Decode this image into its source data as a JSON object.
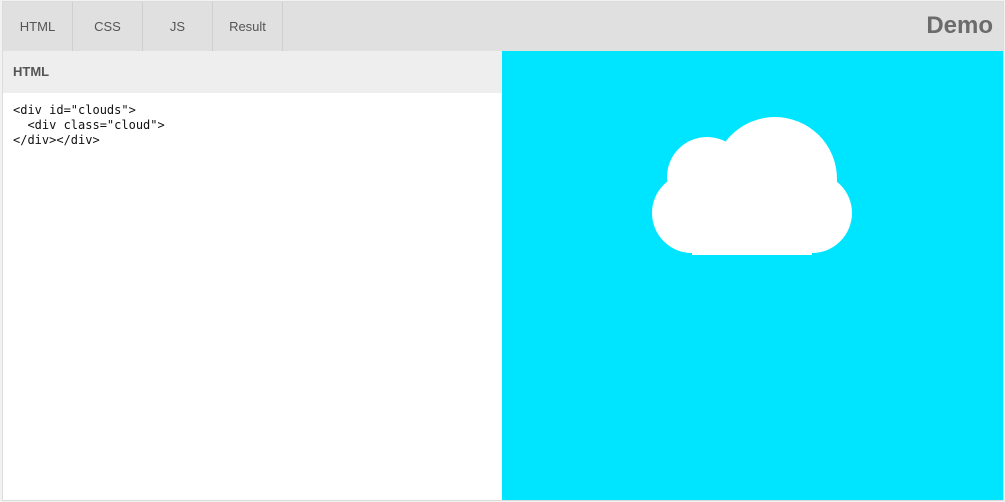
{
  "tabs": [
    {
      "label": "HTML"
    },
    {
      "label": "CSS"
    },
    {
      "label": "JS"
    },
    {
      "label": "Result"
    }
  ],
  "brand": "Demo",
  "html_panel": {
    "title": "HTML",
    "code": "<div id=\"clouds\">\n  <div class=\"cloud\">\n</div></div>"
  },
  "result": {
    "background_color": "#00e5ff",
    "cloud_color": "#ffffff"
  }
}
